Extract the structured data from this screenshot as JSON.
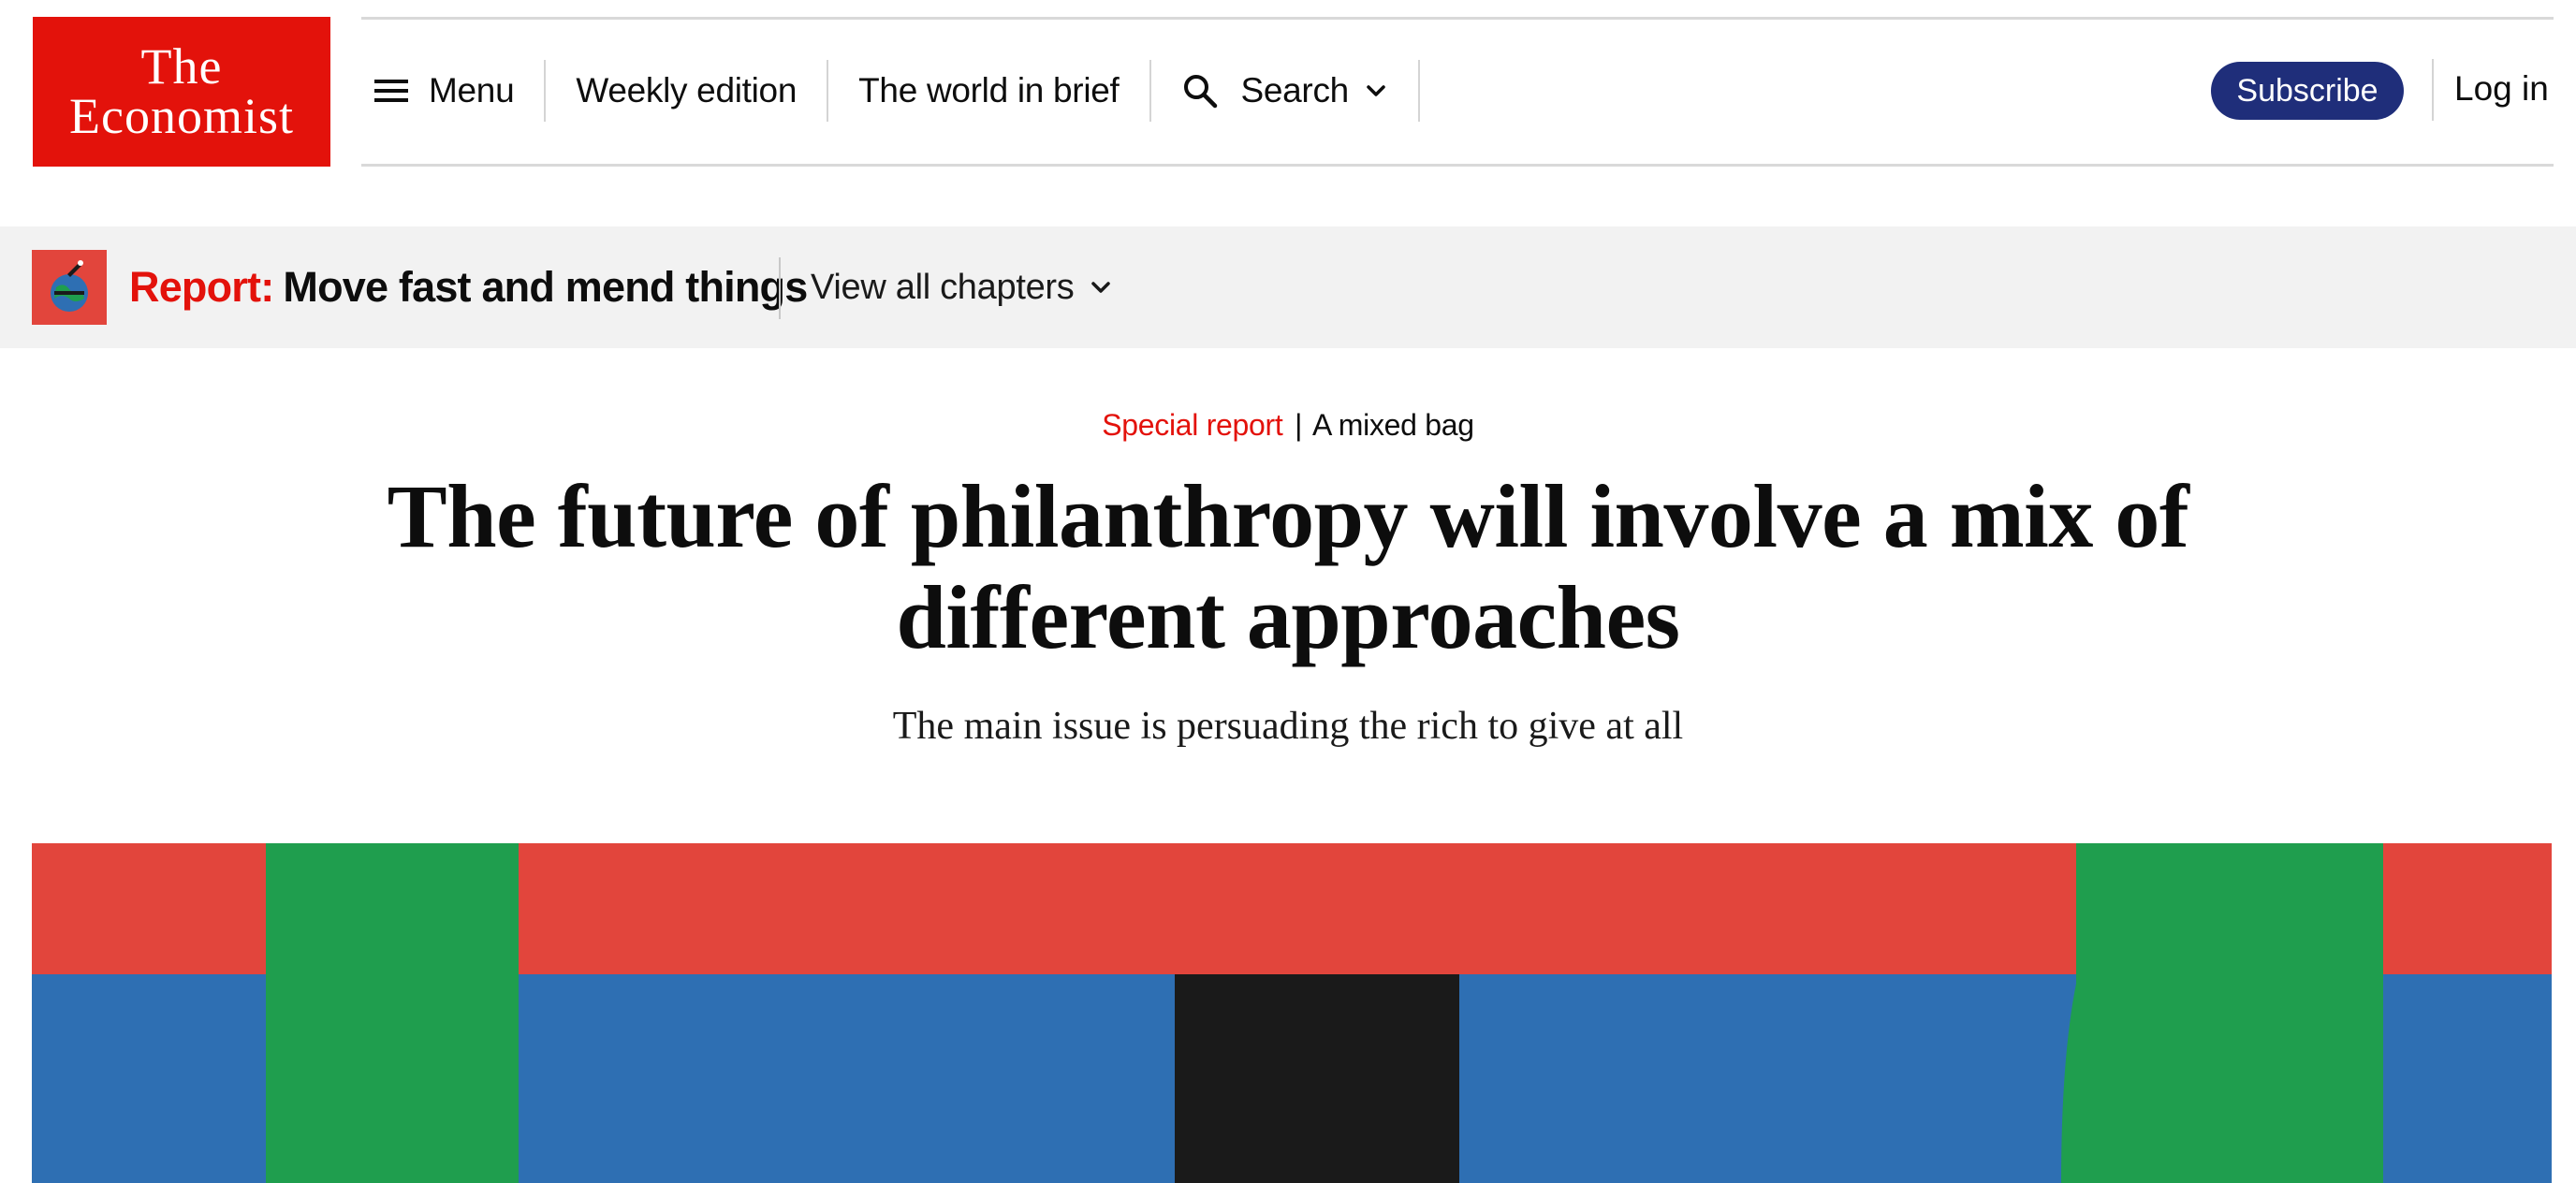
{
  "brand": {
    "logo_line1": "The",
    "logo_line2": "Economist",
    "logo_color": "#e3120b"
  },
  "nav": {
    "menu_label": "Menu",
    "menu_icon": "hamburger-icon",
    "weekly_label": "Weekly edition",
    "brief_label": "The world in brief",
    "search_label": "Search",
    "search_icon": "search-icon",
    "subscribe_label": "Subscribe",
    "subscribe_color": "#1f2e7a",
    "login_label": "Log in"
  },
  "report": {
    "prefix": "Report:",
    "title": "Move fast and mend things",
    "chapters_label": "View all chapters"
  },
  "article": {
    "section": "Special report",
    "separator": "|",
    "rubric": "A mixed bag",
    "headline": "The future of philanthropy will involve a mix of different approaches",
    "standfirst": "The main issue is persuading the rich to give at all"
  },
  "hero": {
    "colors": [
      "#e2453c",
      "#2e6fb3",
      "#1f9e4e",
      "#1a1a1a"
    ]
  }
}
